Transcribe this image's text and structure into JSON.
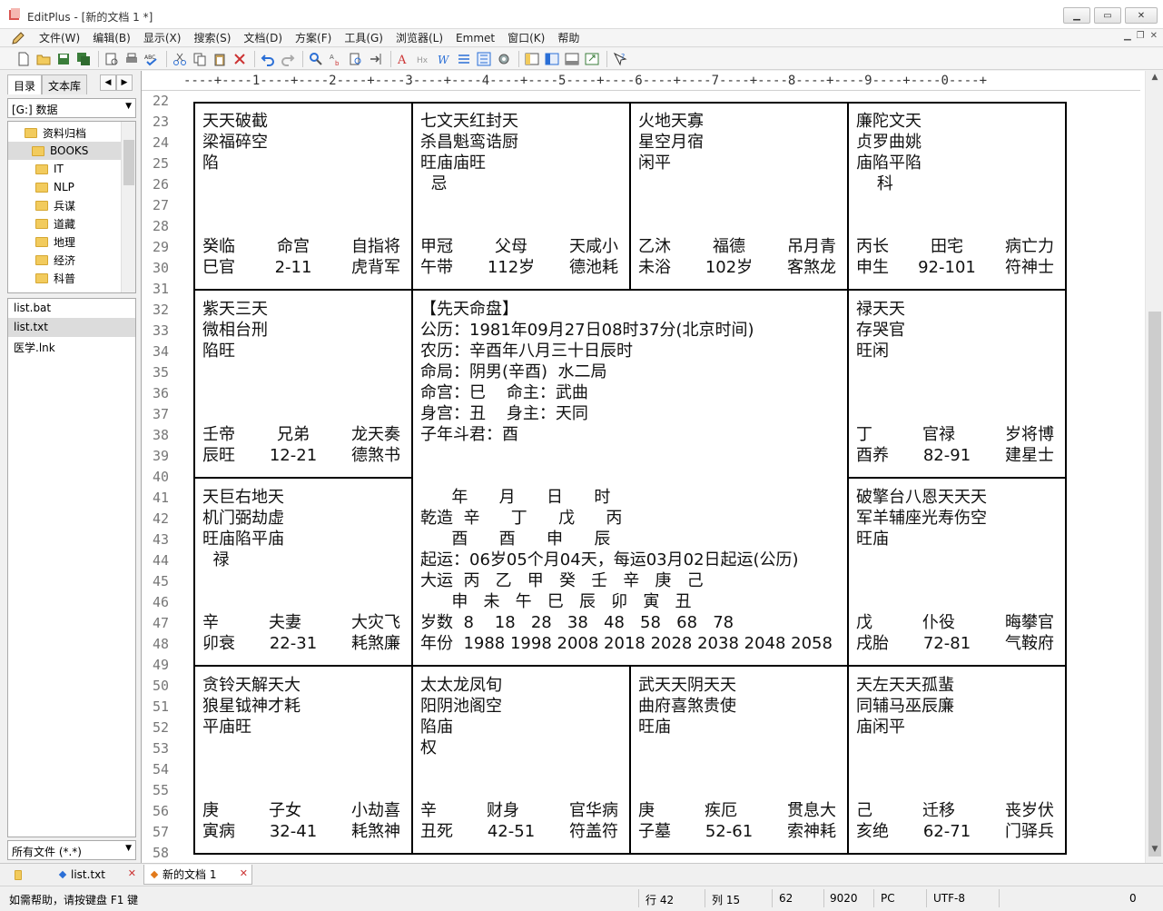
{
  "window": {
    "app_name": "EditPlus",
    "doc_title": "[新的文档 1 *]"
  },
  "menu": [
    "文件(W)",
    "编辑(B)",
    "显示(X)",
    "搜索(S)",
    "文档(D)",
    "方案(F)",
    "工具(G)",
    "浏览器(L)",
    "Emmet",
    "窗口(K)",
    "帮助"
  ],
  "left_panel": {
    "tabs": [
      "目录",
      "文本库"
    ],
    "drive": "[G:] 数据",
    "tree": [
      "资料归档",
      "BOOKS",
      "IT",
      "NLP",
      "兵谋",
      "道藏",
      "地理",
      "经济",
      "科普"
    ],
    "files": [
      "list.bat",
      "list.txt",
      "医学.lnk"
    ],
    "filter": "所有文件 (*.*)"
  },
  "ruler": "----+----1----+----2----+----3----+----4----+----5----+----6----+----7----+----8----+----9----+----0----+",
  "line_numbers": [
    "22",
    "23",
    "24",
    "25",
    "26",
    "27",
    "28",
    "29",
    "30",
    "31",
    "32",
    "33",
    "34",
    "35",
    "36",
    "37",
    "38",
    "39",
    "40",
    "41",
    "42",
    "43",
    "44",
    "45",
    "46",
    "47",
    "48",
    "49",
    "50",
    "51",
    "52",
    "53",
    "54",
    "55",
    "56",
    "57",
    "58"
  ],
  "chart": {
    "c1": {
      "stars": [
        "天天破截",
        "梁福碎空",
        "陷"
      ],
      "b1": [
        "癸临",
        "命宫",
        "自指将"
      ],
      "b2": [
        "巳官",
        "2-11",
        "虎背军"
      ]
    },
    "c2": {
      "stars": [
        "七文天红封天",
        "杀昌魁鸾诰厨",
        "旺庙庙旺",
        "  忌"
      ],
      "b1": [
        "甲冠",
        "父母",
        "天咸小"
      ],
      "b2": [
        "午带",
        "112岁",
        "德池耗"
      ]
    },
    "c3": {
      "stars": [
        "火地天寡",
        "星空月宿",
        "闲平"
      ],
      "b1": [
        "乙沐",
        "福德",
        "吊月青"
      ],
      "b2": [
        "未浴",
        "102岁",
        "客煞龙"
      ]
    },
    "c4": {
      "stars": [
        "廉陀文天",
        "贞罗曲姚",
        "庙陷平陷",
        "    科"
      ],
      "b1": [
        "丙长",
        "田宅",
        "病亡力"
      ],
      "b2": [
        "申生",
        "92-101",
        "符神士"
      ]
    },
    "c5": {
      "stars": [
        "紫天三天",
        "微相台刑",
        "陷旺"
      ],
      "b1": [
        "壬帝",
        "兄弟",
        "龙天奏"
      ],
      "b2": [
        "辰旺",
        "12-21",
        "德煞书"
      ]
    },
    "c6": {
      "stars": [
        "禄天天",
        "存哭官",
        "旺闲"
      ],
      "b1": [
        "丁",
        "官禄",
        "岁将博"
      ],
      "b2": [
        "酉养",
        "82-91",
        "建星士"
      ]
    },
    "c7": {
      "stars": [
        "天巨右地天",
        "机门弼劫虚",
        "旺庙陷平庙",
        "  禄"
      ],
      "b1": [
        "辛",
        "夫妻",
        "大灾飞"
      ],
      "b2": [
        "卯衰",
        "22-31",
        "耗煞廉"
      ]
    },
    "c8": {
      "stars": [
        "破擎台八恩天天天",
        "军羊辅座光寿伤空",
        "旺庙"
      ],
      "b1": [
        "戊",
        "仆役",
        "晦攀官"
      ],
      "b2": [
        "戌胎",
        "72-81",
        "气鞍府"
      ]
    },
    "c9": {
      "stars": [
        "贪铃天解天大",
        "狼星钺神才耗",
        "平庙旺"
      ],
      "b1": [
        "庚",
        "子女",
        "小劫喜"
      ],
      "b2": [
        "寅病",
        "32-41",
        "耗煞神"
      ]
    },
    "c10": {
      "stars": [
        "太太龙凤旬",
        "阳阴池阁空",
        "陷庙",
        "权"
      ],
      "b1": [
        "辛",
        "财身",
        "官华病"
      ],
      "b2": [
        "丑死",
        "42-51",
        "符盖符"
      ]
    },
    "c11": {
      "stars": [
        "武天天阴天天",
        "曲府喜煞贵使",
        "旺庙"
      ],
      "b1": [
        "庚",
        "疾厄",
        "贯息大"
      ],
      "b2": [
        "子墓",
        "52-61",
        "索神耗"
      ]
    },
    "c12": {
      "stars": [
        "天左天天孤蜚",
        "同辅马巫辰廉",
        "庙闲平"
      ],
      "b1": [
        "己",
        "迁移",
        "丧岁伏"
      ],
      "b2": [
        "亥绝",
        "62-71",
        "门驿兵"
      ]
    },
    "center_top": [
      "【先天命盘】",
      "公历：1981年09月27日08时37分(北京时间)",
      "农历：辛酉年八月三十日辰时",
      "命局：阴男(辛酉)  水二局",
      "命宫：巳    命主：武曲",
      "身宫：丑    身主：天同",
      "子年斗君：酉"
    ],
    "center_bottom": [
      "      年      月      日      时",
      "乾造  辛      丁      戊      丙",
      "      酉      酉      申      辰",
      "起运：06岁05个月04天，每运03月02日起运(公历)",
      "大运  丙   乙   甲   癸   壬   辛   庚   己",
      "      申   未   午   巳   辰   卯   寅   丑",
      "岁数  8    18   28   38   48   58   68   78",
      "年份  1988 1998 2008 2018 2028 2038 2048 2058"
    ]
  },
  "doc_tabs": [
    "list.txt",
    "新的文档 1"
  ],
  "status": {
    "help": "如需帮助，请按键盘 F1 键",
    "row": "行 42",
    "col": "列 15",
    "n1": "62",
    "n2": "9020",
    "mode": "PC",
    "encoding": "UTF-8",
    "n3": "0"
  }
}
